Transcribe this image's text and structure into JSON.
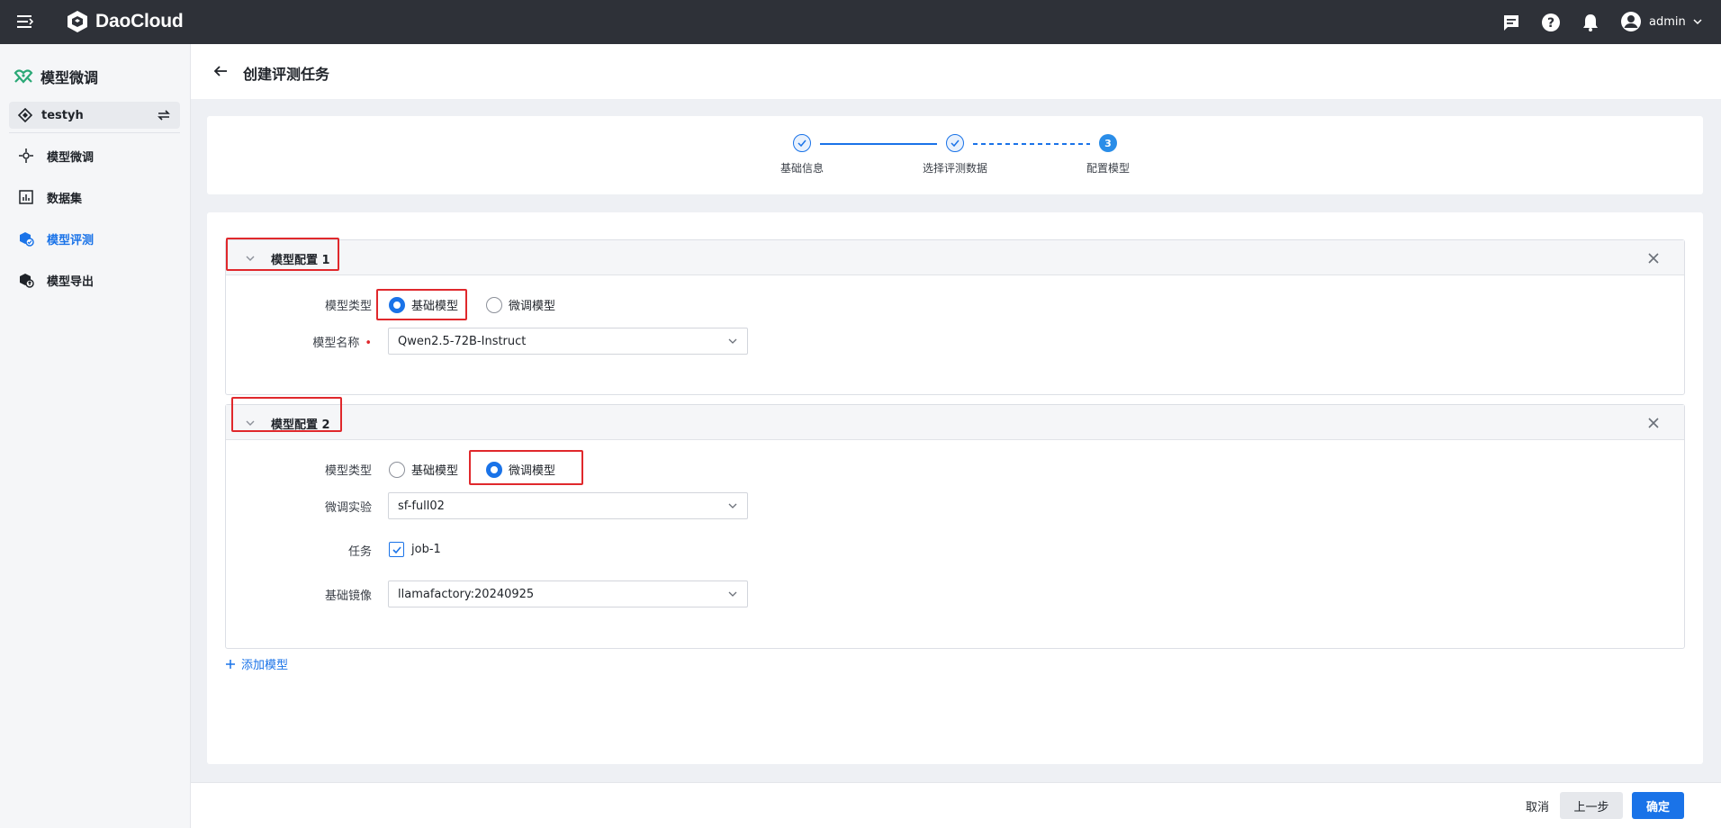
{
  "topbar": {
    "logo_text": "DaoCloud",
    "user_name": "admin"
  },
  "sidebar": {
    "title": "模型微调",
    "workspace": "testyh",
    "items": [
      {
        "label": "模型微调",
        "icon": "fine-tune-icon"
      },
      {
        "label": "数据集",
        "icon": "dataset-icon"
      },
      {
        "label": "模型评测",
        "icon": "evaluation-icon",
        "active": true
      },
      {
        "label": "模型导出",
        "icon": "export-icon"
      }
    ]
  },
  "header": {
    "title": "创建评测任务"
  },
  "steps": [
    {
      "label": "基础信息",
      "state": "done"
    },
    {
      "label": "选择评测数据",
      "state": "done"
    },
    {
      "label": "配置模型",
      "state": "current",
      "number": "3"
    }
  ],
  "panels": [
    {
      "title": "模型配置 1",
      "model_type_label": "模型类型",
      "option_base": "基础模型",
      "option_finetune": "微调模型",
      "selected": "base",
      "model_name_label": "模型名称",
      "model_name_value": "Qwen2.5-72B-Instruct"
    },
    {
      "title": "模型配置 2",
      "model_type_label": "模型类型",
      "option_base": "基础模型",
      "option_finetune": "微调模型",
      "selected": "finetune",
      "experiment_label": "微调实验",
      "experiment_value": "sf-full02",
      "task_label": "任务",
      "task_value": "job-1",
      "image_label": "基础镜像",
      "image_value": "llamafactory:20240925"
    }
  ],
  "add_model_label": "添加模型",
  "footer": {
    "cancel": "取消",
    "prev": "上一步",
    "ok": "确定"
  },
  "colors": {
    "primary": "#1a73e8",
    "topbar": "#2e3138",
    "highlight": "#e0282c"
  }
}
